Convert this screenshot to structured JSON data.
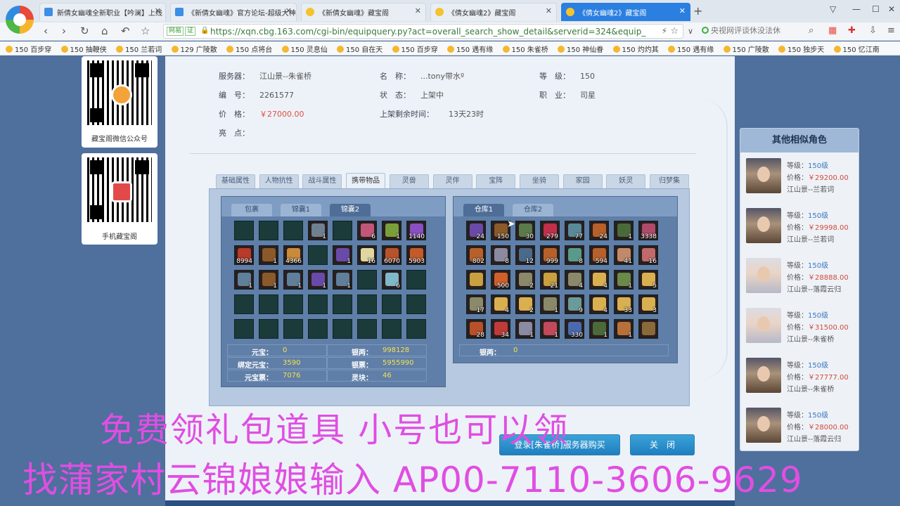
{
  "browser": {
    "tabs": [
      {
        "label": "新倩女幽魂全新职业【吟澜】上线",
        "icon": "game-site-icon"
      },
      {
        "label": "《新倩女幽魂》官方论坛-超级大神",
        "icon": "game-site-icon"
      },
      {
        "label": "《新倩女幽魂》藏宝阁",
        "icon": "coin-icon"
      },
      {
        "label": "《倩女幽魂2》藏宝阁",
        "icon": "coin-icon"
      },
      {
        "label": "《倩女幽魂2》藏宝阁",
        "icon": "coin-icon",
        "active": true
      }
    ],
    "address_badges": [
      "网易",
      "证"
    ],
    "url": "https://xqn.cbg.163.com/cgi-bin/equipquery.py?act=overall_search_show_detail&serverid=324&equip_id=",
    "search_placeholder": "央视网评谈休没法休",
    "bookmarks": [
      "150 百步穿",
      "150 抽鞭侠",
      "150 兰若词",
      "129 广陵散",
      "150 点将台",
      "150 灵息仙",
      "150 自在天",
      "150 百步穿",
      "150 遇有缘",
      "150 朱雀桥",
      "150 神仙眷",
      "150 灼灼其",
      "150 遇有缘",
      "150 广陵散",
      "150 独步天",
      "150 忆江南"
    ]
  },
  "qr": [
    {
      "label": "藏宝阁微信公众号",
      "icon": "wechat-qr-icon"
    },
    {
      "label": "手机藏宝阁",
      "icon": "app-qr-icon"
    }
  ],
  "info": {
    "server_label": "服务器：",
    "server": "江山景--朱雀桥",
    "name_label": "名　称：",
    "name": "...tony带水º",
    "level_label": "等　级：",
    "level": "150",
    "id_label": "编　号：",
    "id": "2261577",
    "status_label": "状　态：",
    "status": "上架中",
    "job_label": "职　业：",
    "job": "司星",
    "price_label": "价　格：",
    "price": "￥27000.00",
    "remain_label": "上架剩余时间：",
    "remain": "13天23时",
    "highlight_label": "亮　点："
  },
  "tabs": [
    "基础属性",
    "人物抗性",
    "战斗属性",
    "携带物品",
    "灵兽",
    "灵伴",
    "宝阵",
    "坐骑",
    "家园",
    "妖灵",
    "归梦集"
  ],
  "active_tab": 3,
  "bag": {
    "tabs": [
      "包裹",
      "锦囊1",
      "锦囊2"
    ],
    "active": 2,
    "cells": [
      {
        "c": "",
        "n": ""
      },
      {
        "c": "",
        "n": ""
      },
      {
        "c": "",
        "n": ""
      },
      {
        "c": "#6f8090",
        "n": "1"
      },
      {
        "c": "",
        "n": ""
      },
      {
        "c": "#c0577a",
        "n": "6"
      },
      {
        "c": "#7a9f3a",
        "n": "1"
      },
      {
        "c": "#8a4fc0",
        "n": "1140"
      },
      {
        "c": "#b83a2a",
        "n": "8994"
      },
      {
        "c": "#8a5a2a",
        "n": "1"
      },
      {
        "c": "#c98a3a",
        "n": "4366"
      },
      {
        "c": "",
        "n": ""
      },
      {
        "c": "#6a4aa8",
        "n": "1"
      },
      {
        "c": "#e0d6a0",
        "n": "16"
      },
      {
        "c": "#b8522a",
        "n": "6070"
      },
      {
        "c": "#c45a2a",
        "n": "5903"
      },
      {
        "c": "#5f7f9a",
        "n": "1"
      },
      {
        "c": "#8a5a2a",
        "n": "1"
      },
      {
        "c": "#5f7f9a",
        "n": "1"
      },
      {
        "c": "#6a4aa8",
        "n": "1"
      },
      {
        "c": "#5f7f9a",
        "n": "1"
      },
      {
        "c": "",
        "n": ""
      },
      {
        "c": "#7fb8c8",
        "n": "6"
      },
      {
        "c": "",
        "n": ""
      },
      {
        "c": "",
        "n": ""
      },
      {
        "c": "",
        "n": ""
      },
      {
        "c": "",
        "n": ""
      },
      {
        "c": "",
        "n": ""
      },
      {
        "c": "",
        "n": ""
      },
      {
        "c": "",
        "n": ""
      },
      {
        "c": "",
        "n": ""
      },
      {
        "c": "",
        "n": ""
      },
      {
        "c": "",
        "n": ""
      },
      {
        "c": "",
        "n": ""
      },
      {
        "c": "",
        "n": ""
      },
      {
        "c": "",
        "n": ""
      },
      {
        "c": "",
        "n": ""
      },
      {
        "c": "",
        "n": ""
      },
      {
        "c": "",
        "n": ""
      },
      {
        "c": "",
        "n": ""
      }
    ],
    "money": [
      {
        "label": "元宝：",
        "value": "0"
      },
      {
        "label": "银两：",
        "value": "998128"
      },
      {
        "label": "绑定元宝：",
        "value": "3590"
      },
      {
        "label": "银票：",
        "value": "5955990"
      },
      {
        "label": "元宝票：",
        "value": "7076"
      },
      {
        "label": "灵块：",
        "value": "46"
      }
    ]
  },
  "warehouse": {
    "tabs": [
      "仓库1",
      "仓库2"
    ],
    "active": 0,
    "cells": [
      {
        "c": "#6a4aa8",
        "n": "24"
      },
      {
        "c": "#8a5a2a",
        "n": "150"
      },
      {
        "c": "#5a7a4a",
        "n": "30"
      },
      {
        "c": "#c0304a",
        "n": "279"
      },
      {
        "c": "#5a8a9a",
        "n": "77"
      },
      {
        "c": "#b8602a",
        "n": "24"
      },
      {
        "c": "#4a6a3a",
        "n": "1"
      },
      {
        "c": "#b04a6a",
        "n": "3338"
      },
      {
        "c": "#b8602a",
        "n": "802"
      },
      {
        "c": "#8a8aa0",
        "n": "8"
      },
      {
        "c": "#4a6a8a",
        "n": "12"
      },
      {
        "c": "#b8602a",
        "n": "999"
      },
      {
        "c": "#5a9a8a",
        "n": "8"
      },
      {
        "c": "#b8602a",
        "n": "594"
      },
      {
        "c": "#c08a6a",
        "n": "41"
      },
      {
        "c": "#c06a6a",
        "n": "16"
      },
      {
        "c": "#c8a040",
        "n": ""
      },
      {
        "c": "#d0602a",
        "n": "500"
      },
      {
        "c": "#8a8a6a",
        "n": "2"
      },
      {
        "c": "#c8a040",
        "n": "21"
      },
      {
        "c": "#8a8a6a",
        "n": "4"
      },
      {
        "c": "#d8b050",
        "n": "4"
      },
      {
        "c": "#6a8a4a",
        "n": "1"
      },
      {
        "c": "#d8b050",
        "n": "5"
      },
      {
        "c": "#8a8a6a",
        "n": "17"
      },
      {
        "c": "#d8b050",
        "n": "4"
      },
      {
        "c": "#d8b050",
        "n": "2"
      },
      {
        "c": "#8a8a6a",
        "n": "1"
      },
      {
        "c": "#6a9a9a",
        "n": "9"
      },
      {
        "c": "#d8b050",
        "n": "4"
      },
      {
        "c": "#d8b050",
        "n": "33"
      },
      {
        "c": "#d8b050",
        "n": "3"
      },
      {
        "c": "#b8502a",
        "n": "28"
      },
      {
        "c": "#c03a3a",
        "n": "34"
      },
      {
        "c": "#8a8aa0",
        "n": "1"
      },
      {
        "c": "#c04a5a",
        "n": "1"
      },
      {
        "c": "#4a6ab0",
        "n": "330"
      },
      {
        "c": "#4a6a3a",
        "n": "1"
      },
      {
        "c": "#b8703a",
        "n": "1"
      },
      {
        "c": "#8a6a3a",
        "n": ""
      }
    ],
    "money_label": "银两：",
    "money_value": "0"
  },
  "side": {
    "title": "其他相似角色",
    "roles": [
      {
        "level_label": "等级：",
        "level": "150级",
        "price_label": "价格：",
        "price": "￥29200.00",
        "server": "江山景--兰若词",
        "light": false
      },
      {
        "level_label": "等级：",
        "level": "150级",
        "price_label": "价格：",
        "price": "￥29998.00",
        "server": "江山景--兰若词",
        "light": false
      },
      {
        "level_label": "等级：",
        "level": "150级",
        "price_label": "价格：",
        "price": "￥28888.00",
        "server": "江山景--落霞云归",
        "light": true
      },
      {
        "level_label": "等级：",
        "level": "150级",
        "price_label": "价格：",
        "price": "￥31500.00",
        "server": "江山景--朱雀桥",
        "light": true
      },
      {
        "level_label": "等级：",
        "level": "150级",
        "price_label": "价格：",
        "price": "￥27777.00",
        "server": "江山景--朱雀桥",
        "light": false
      },
      {
        "level_label": "等级：",
        "level": "150级",
        "price_label": "价格：",
        "price": "￥28000.00",
        "server": "江山景--落霞云归",
        "light": false
      }
    ]
  },
  "buttons": {
    "login": "登录[朱雀桥]服务器购买",
    "close": "关　闭"
  },
  "overlay": {
    "line1": "免费领礼包道具 小号也可以领",
    "line2": "找蒲家村云锦娘娘输入 AP00-7110-3606-9629"
  }
}
